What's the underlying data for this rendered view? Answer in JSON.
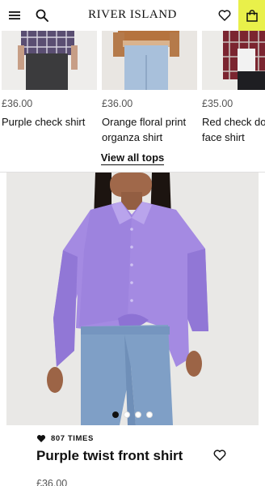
{
  "header": {
    "brand": "RIVER ISLAND",
    "icons": [
      "menu-icon",
      "search-icon",
      "heart-icon",
      "bag-icon"
    ],
    "accent_color": "#e9f04a"
  },
  "carousel": {
    "items": [
      {
        "price": "£36.00",
        "name_line1": "Purple check shirt",
        "name_line2": ""
      },
      {
        "price": "£36.00",
        "name_line1": "Orange floral print",
        "name_line2": "organza shirt"
      },
      {
        "price": "£35.00",
        "name_line1": "Red check do",
        "name_line2": "face shirt"
      }
    ],
    "view_all_label": "View all tops"
  },
  "gallery": {
    "dots": 4,
    "active_dot": 1
  },
  "product": {
    "wishlist_count": "807 TIMES",
    "title": "Purple twist front shirt",
    "price": "£36.00"
  }
}
